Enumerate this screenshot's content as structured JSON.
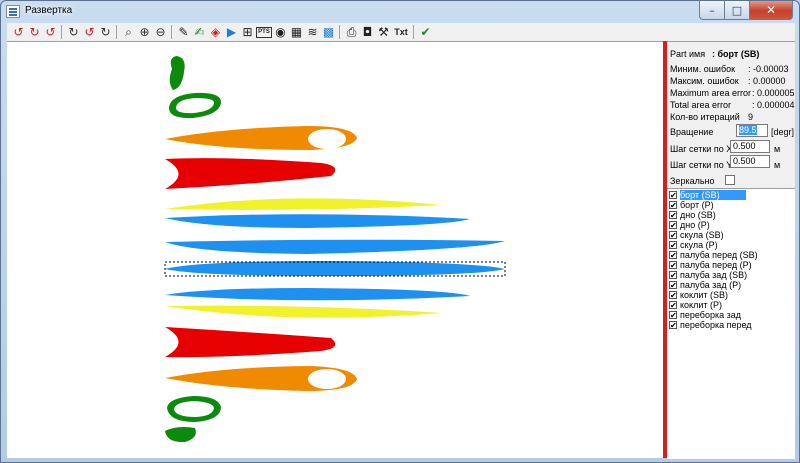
{
  "window": {
    "title": "Развертка"
  },
  "window_buttons": {
    "minimize": "–",
    "maximize": "□",
    "close": "✕"
  },
  "toolbar": {
    "buttons": [
      {
        "icon": "rotate-red-icon",
        "glyph": "↺",
        "cls": "red"
      },
      {
        "icon": "rotate-red-cw-icon",
        "glyph": "↻",
        "cls": "red"
      },
      {
        "icon": "rotate-red-step-icon",
        "glyph": "↺",
        "cls": "red"
      },
      {
        "icon": "rotate-grey-icon",
        "glyph": "↻",
        "cls": "grey"
      },
      {
        "icon": "rotate-grey-red-icon",
        "glyph": "↺",
        "cls": "red"
      },
      {
        "icon": "rotate-grey-step-icon",
        "glyph": "↻",
        "cls": "grey"
      },
      {
        "icon": "zoom-fit-icon",
        "glyph": "⌕",
        "cls": "grey"
      },
      {
        "icon": "zoom-in-icon",
        "glyph": "⊕",
        "cls": "grey"
      },
      {
        "icon": "zoom-out-icon",
        "glyph": "⊖",
        "cls": "grey"
      },
      {
        "icon": "pencil-icon",
        "glyph": "✎",
        "cls": "dark"
      },
      {
        "icon": "edit-green-icon",
        "glyph": "✍",
        "cls": "green"
      },
      {
        "icon": "eraser-icon",
        "glyph": "◈",
        "cls": "red"
      },
      {
        "icon": "play-icon",
        "glyph": "▶",
        "cls": "blue"
      },
      {
        "icon": "node-icon",
        "glyph": "⊞",
        "cls": "dark"
      },
      {
        "icon": "points-icon",
        "glyph": "PTS",
        "cls": "dark"
      },
      {
        "icon": "camera-icon",
        "glyph": "◉",
        "cls": "dark"
      },
      {
        "icon": "film-icon",
        "glyph": "▦",
        "cls": "dark"
      },
      {
        "icon": "layers-icon",
        "glyph": "≋",
        "cls": "dark"
      },
      {
        "icon": "grid-icon",
        "glyph": "▩",
        "cls": "blue"
      },
      {
        "icon": "print-icon",
        "glyph": "⎙",
        "cls": "dark"
      },
      {
        "icon": "save-icon",
        "glyph": "◘",
        "cls": "dark"
      },
      {
        "icon": "tools-icon",
        "glyph": "⚒",
        "cls": "dark"
      },
      {
        "icon": "text-icon",
        "glyph": "Txt",
        "cls": "dark"
      },
      {
        "icon": "check-icon",
        "glyph": "✔",
        "cls": "green"
      }
    ]
  },
  "info": {
    "part_label": "Part имя",
    "part_value": ": борт (SB)",
    "min_err_label": "Миним. ошибок",
    "min_err_value": ": -0.00003",
    "max_err_label": "Максим. ошибок",
    "max_err_value": ": 0.00000",
    "max_area_label": "Maximum area error",
    "max_area_value": ": 0.000005",
    "total_area_label": "Total area error",
    "total_area_value": ": 0.000004",
    "iter_label": "Кол-во итераций",
    "iter_value": "9",
    "rotation_label": "Вращение",
    "rotation_value": "89.5",
    "rotation_unit": "[degr]",
    "gridx_label": "Шаг сетки по X",
    "gridx_value": "0.500",
    "gridx_unit": "м",
    "gridy_label": "Шаг сетки по Y",
    "gridy_value": "0.500",
    "gridy_unit": "м",
    "mirror_label": "Зеркально",
    "mirror_checked": false
  },
  "parts": [
    {
      "label": "борт (SB)",
      "checked": true,
      "selected": true
    },
    {
      "label": "борт (P)",
      "checked": true
    },
    {
      "label": "дно (SB)",
      "checked": true
    },
    {
      "label": "дно (P)",
      "checked": true
    },
    {
      "label": "скула (SB)",
      "checked": true
    },
    {
      "label": "скула (P)",
      "checked": true
    },
    {
      "label": "палуба перед (SB)",
      "checked": true
    },
    {
      "label": "палуба перед (P)",
      "checked": true
    },
    {
      "label": "палуба зад (SB)",
      "checked": true
    },
    {
      "label": "палуба зад (P)",
      "checked": true
    },
    {
      "label": "коклит (SB)",
      "checked": true
    },
    {
      "label": "коклит (P)",
      "checked": true
    },
    {
      "label": "переборка зад",
      "checked": true
    },
    {
      "label": "переборка перед",
      "checked": true
    }
  ],
  "colors": {
    "green": "#0b8a0b",
    "orange": "#f08a00",
    "red": "#e60000",
    "yellow": "#f2f22a",
    "blue": "#1e90ef",
    "divider": "#d21f1f"
  },
  "canvas_shapes": [
    "bulkhead-front-shape",
    "cockpit-shape",
    "deck-front-shape",
    "deck-rear-shape",
    "chine-shape",
    "bottom-shape",
    "side-shape",
    "side-selected-shape",
    "bottom-shape",
    "chine-shape",
    "deck-rear-shape",
    "deck-front-shape",
    "cockpit-shape",
    "bulkhead-rear-shape"
  ]
}
